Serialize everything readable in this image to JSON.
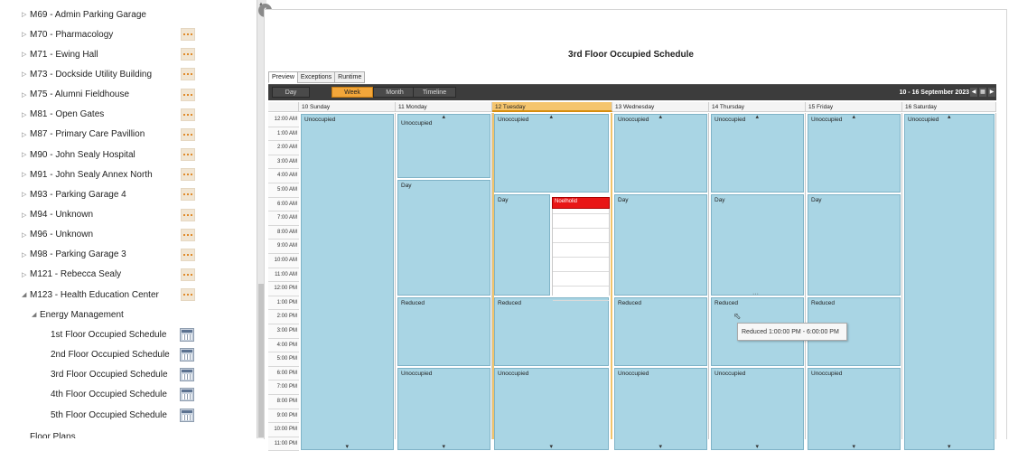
{
  "tree": {
    "buildings": [
      {
        "label": "M69 - Admin Parking Garage"
      },
      {
        "label": "M70 - Pharmacology"
      },
      {
        "label": "M71 - Ewing Hall"
      },
      {
        "label": "M73 - Dockside Utility Building"
      },
      {
        "label": "M75 - Alumni Fieldhouse"
      },
      {
        "label": "M81 - Open Gates"
      },
      {
        "label": "M87 - Primary Care Pavillion"
      },
      {
        "label": "M90 - John Sealy Hospital"
      },
      {
        "label": "M91 - John Sealy Annex North"
      },
      {
        "label": "M93 - Parking Garage 4"
      },
      {
        "label": "M94 - Unknown"
      },
      {
        "label": "M96 - Unknown"
      },
      {
        "label": "M98 - Parking Garage 3"
      },
      {
        "label": "M121 - Rebecca Sealy"
      },
      {
        "label": "M123 - Health Education Center"
      }
    ],
    "group": "Energy Management",
    "schedules": [
      {
        "label": "1st Floor Occupied Schedule"
      },
      {
        "label": "2nd Floor Occupied Schedule"
      },
      {
        "label": "3rd Floor Occupied Schedule"
      },
      {
        "label": "4th Floor Occupied Schedule"
      },
      {
        "label": "5th Floor Occupied Schedule"
      }
    ],
    "last_partial": "Floor Plans"
  },
  "schedule": {
    "title": "3rd Floor Occupied Schedule",
    "tabs": [
      "Preview",
      "Exceptions",
      "Runtime"
    ],
    "active_tab": "Preview",
    "views": [
      "Day",
      "Week",
      "Month",
      "Timeline"
    ],
    "active_view": "Week",
    "date_range": "10 - 16 September 2023",
    "days": [
      "10 Sunday",
      "11 Monday",
      "12 Tuesday",
      "13 Wednesday",
      "14 Thursday",
      "15 Friday",
      "16 Saturday"
    ],
    "today": "12 Tuesday",
    "times": [
      "12:00 AM",
      "1:00 AM",
      "2:00 AM",
      "3:00 AM",
      "4:00 AM",
      "5:00 AM",
      "6:00 AM",
      "7:00 AM",
      "8:00 AM",
      "9:00 AM",
      "10:00 AM",
      "11:00 AM",
      "12:00 PM",
      "1:00 PM",
      "2:00 PM",
      "3:00 PM",
      "4:00 PM",
      "5:00 PM",
      "6:00 PM",
      "7:00 PM",
      "8:00 PM",
      "9:00 PM",
      "10:00 PM",
      "11:00 PM"
    ],
    "labels": {
      "unoccupied": "Unoccupied",
      "day": "Day",
      "reduced": "Reduced",
      "holiday": "Noelholid"
    },
    "tooltip": "Reduced  1:00:00 PM - 6:00:00 PM",
    "colors": {
      "event": "#a9d5e4",
      "holiday": "#e81616",
      "today": "#f5c56e",
      "toolbar": "#3c3c3c"
    }
  }
}
